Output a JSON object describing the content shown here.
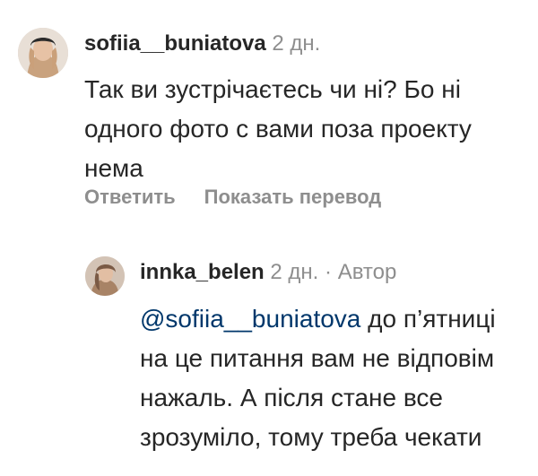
{
  "comment": {
    "username": "sofiia__buniatova",
    "time": "2 дн.",
    "text": "Так ви зустрічаєтесь чи ні? Бо ні одного фото с вами поза проекту нема",
    "reply_label": "Ответить",
    "translate_label": "Показать перевод"
  },
  "reply": {
    "username": "innka_belen",
    "time": "2 дн.",
    "separator": "·",
    "author_label": "Автор",
    "mention": "@sofiia__buniatova",
    "text": " до п’ятниці на це питання вам не відповім нажаль. А після стане все зрозуміло, тому треба чекати"
  },
  "colors": {
    "text": "#262626",
    "secondary": "#8e8e8e",
    "mention": "#00376b"
  }
}
